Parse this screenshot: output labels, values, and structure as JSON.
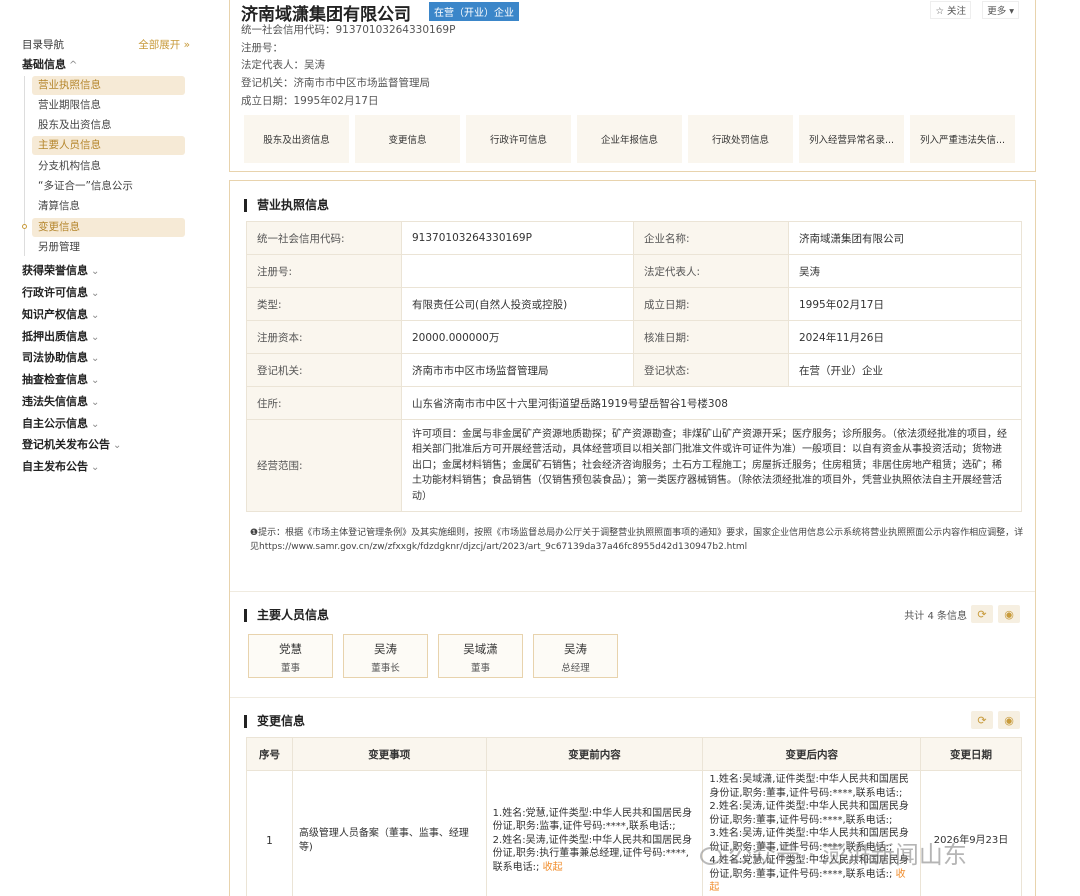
{
  "nav": {
    "title": "目录导航",
    "expand_all": "全部展开",
    "groups": [
      {
        "label": "基础信息"
      },
      {
        "label": "获得荣誉信息"
      },
      {
        "label": "行政许可信息"
      },
      {
        "label": "知识产权信息"
      },
      {
        "label": "抵押出质信息"
      },
      {
        "label": "司法协助信息"
      },
      {
        "label": "抽查检查信息"
      },
      {
        "label": "违法失信信息"
      },
      {
        "label": "自主公示信息"
      },
      {
        "label": "登记机关发布公告"
      },
      {
        "label": "自主发布公告"
      }
    ],
    "items": [
      {
        "label": "营业执照信息"
      },
      {
        "label": "营业期限信息"
      },
      {
        "label": "股东及出资信息"
      },
      {
        "label": "主要人员信息"
      },
      {
        "label": "分支机构信息"
      },
      {
        "label": "“多证合一”信息公示"
      },
      {
        "label": "清算信息"
      },
      {
        "label": "变更信息"
      },
      {
        "label": "另册管理"
      }
    ]
  },
  "header": {
    "company_name": "济南域潇集团有限公司",
    "status": "在营（开业）企业",
    "follow": "☆ 关注",
    "more": "更多 ▾",
    "info": [
      "统一社会信用代码：91370103264330169P",
      "注册号：",
      "法定代表人：吴涛",
      "登记机关：济南市市中区市场监督管理局",
      "成立日期：1995年02月17日"
    ],
    "quick_links": [
      "股东及出资信息",
      "变更信息",
      "行政许可信息",
      "企业年报信息",
      "行政处罚信息",
      "列入经营异常名录...",
      "列入严重违法失信..."
    ]
  },
  "license": {
    "title": "营业执照信息",
    "rows": [
      {
        "k1": "统一社会信用代码:",
        "v1": "91370103264330169P",
        "k2": "企业名称:",
        "v2": "济南域潇集团有限公司"
      },
      {
        "k1": "注册号:",
        "v1": "",
        "k2": "法定代表人:",
        "v2": "吴涛"
      },
      {
        "k1": "类型:",
        "v1": "有限责任公司(自然人投资或控股)",
        "k2": "成立日期:",
        "v2": "1995年02月17日"
      },
      {
        "k1": "注册资本:",
        "v1": "20000.000000万",
        "k2": "核准日期:",
        "v2": "2024年11月26日"
      },
      {
        "k1": "登记机关:",
        "v1": "济南市市中区市场监督管理局",
        "k2": "登记状态:",
        "v2": "在营（开业）企业"
      }
    ],
    "address_label": "住所:",
    "address": "山东省济南市市中区十六里河街道望岳路1919号望岳智谷1号楼308",
    "scope_label": "经营范围:",
    "scope": "许可项目：金属与非金属矿产资源地质勘探；矿产资源勘查；非煤矿山矿产资源开采；医疗服务；诊所服务。（依法须经批准的项目，经相关部门批准后方可开展经营活动，具体经营项目以相关部门批准文件或许可证件为准）一般项目：以自有资金从事投资活动；货物进出口；金属材料销售；金属矿石销售；社会经济咨询服务；土石方工程施工；房屋拆迁服务；住房租赁；非居住房地产租赁；选矿；稀土功能材料销售；食品销售（仅销售预包装食品）；第一类医疗器械销售。（除依法须经批准的项目外，凭营业执照依法自主开展经营活动）",
    "notice": "❶提示：根据《市场主体登记管理条例》及其实施细则，按照《市场监督总局办公厅关于调整营业执照照面事项的通知》要求，国家企业信用信息公示系统将营业执照照面公示内容作相应调整，详见https://www.samr.gov.cn/zw/zfxxgk/fdzdgknr/djzcj/art/2023/art_9c67139da37a46fc8955d42d130947b2.html"
  },
  "people": {
    "title": "主要人员信息",
    "count": "共计 4 条信息",
    "list": [
      {
        "name": "党慧",
        "role": "董事"
      },
      {
        "name": "吴涛",
        "role": "董事长"
      },
      {
        "name": "吴域潇",
        "role": "董事"
      },
      {
        "name": "吴涛",
        "role": "总经理"
      }
    ]
  },
  "changes": {
    "title": "变更信息",
    "headers": [
      "序号",
      "变更事项",
      "变更前内容",
      "变更后内容",
      "变更日期"
    ],
    "row": {
      "no": "1",
      "item": "高级管理人员备案（董事、监事、经理等)",
      "before": "1.姓名:党慧,证件类型:中华人民共和国居民身份证,职务:监事,证件号码:****,联系电话:;\n2.姓名:吴涛,证件类型:中华人民共和国居民身份证,职务:执行董事兼总经理,证件号码:****,联系电话:;",
      "before_fold": "收起",
      "after": "1.姓名:吴域潇,证件类型:中华人民共和国居民身份证,职务:董事,证件号码:****,联系电话:;\n2.姓名:吴涛,证件类型:中华人民共和国居民身份证,职务:董事,证件号码:****,联系电话:;\n3.姓名:吴涛,证件类型:中华人民共和国居民身份证,职务:董事,证件号码:****,联系电话:;\n4.姓名:党慧,证件类型:中华人民共和国居民身份证,职务:董事,证件号码:****,联系电话:;",
      "after_fold": "收起",
      "date": "2026年9月23日"
    }
  },
  "watermark": "公众号 · 澎湃新闻山东"
}
